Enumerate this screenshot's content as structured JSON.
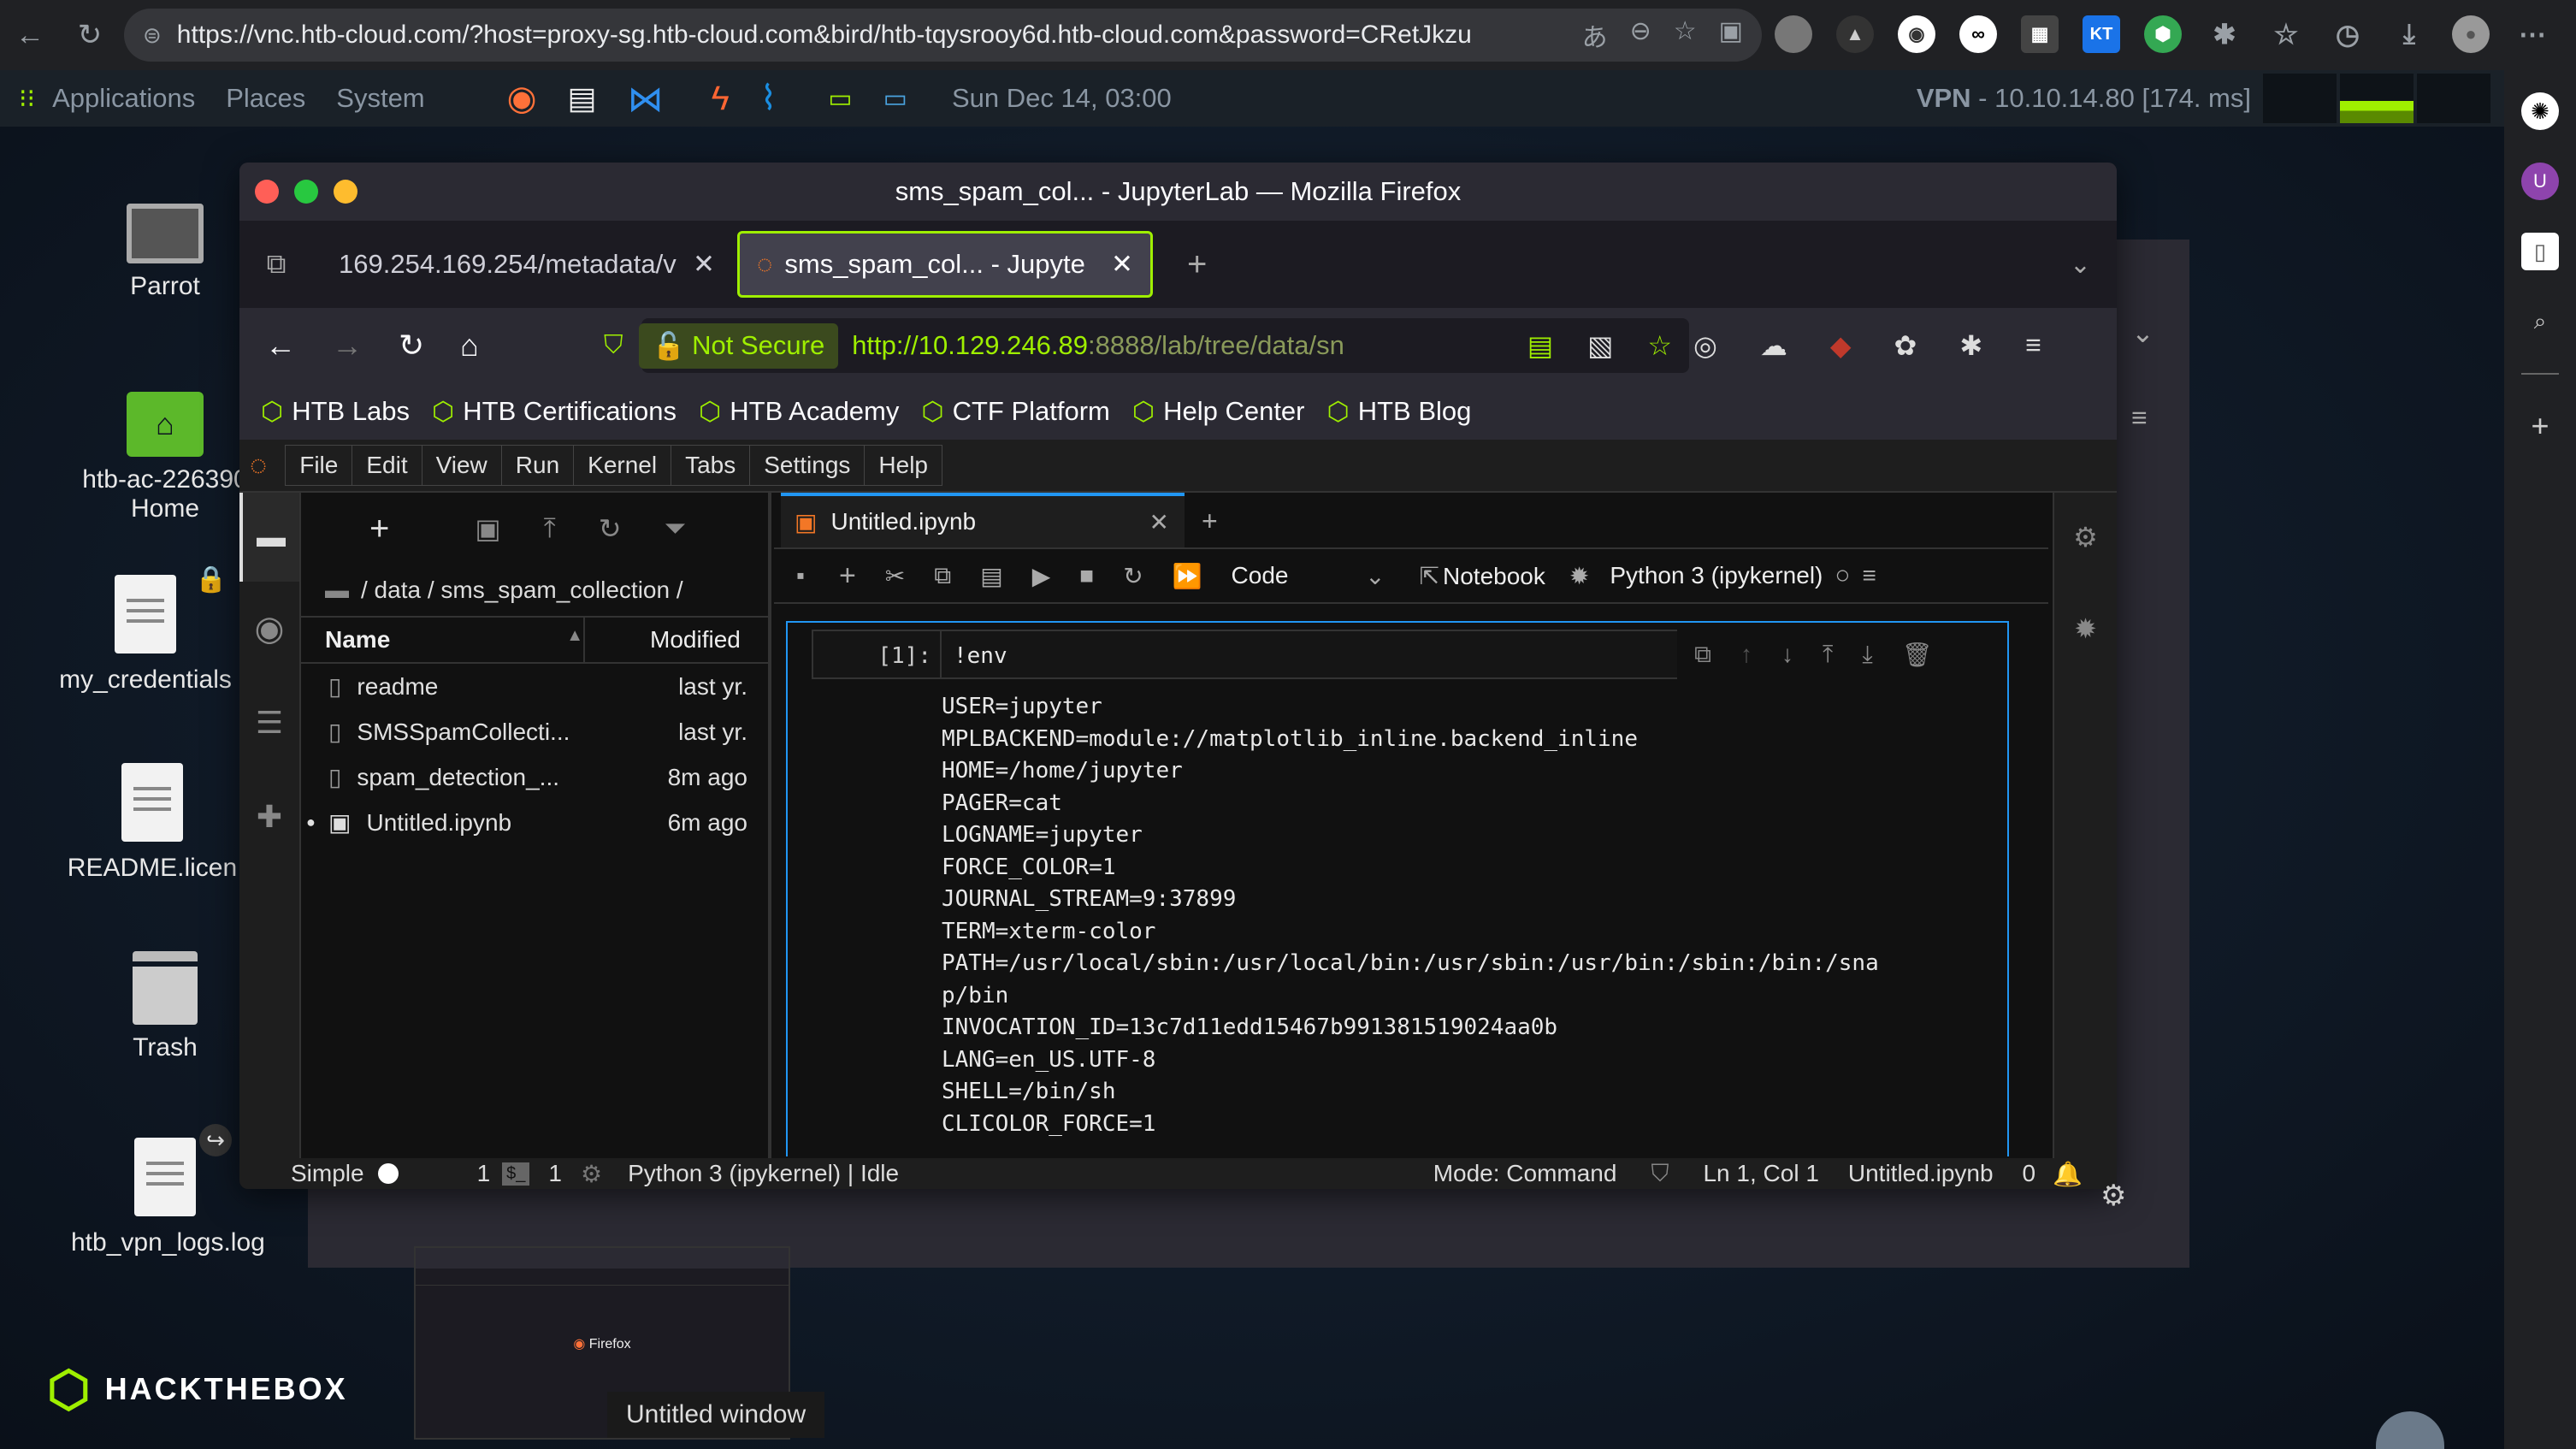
{
  "chrome": {
    "url": "https://vnc.htb-cloud.com/?host=proxy-sg.htb-cloud.com&bird/htb-tqysrooy6d.htb-cloud.com&password=CRetJkzu",
    "ext_badges": [
      "KT"
    ]
  },
  "panel": {
    "applications": "Applications",
    "places": "Places",
    "system": "System",
    "clock": "Sun Dec 14, 03:00",
    "vpn_label": "VPN",
    "vpn_value": " - 10.10.14.80 [174. ms]"
  },
  "desktop": {
    "icons": [
      "Parrot",
      "htb-ac-226390",
      "Home",
      "my_credentials",
      "README.licen",
      "Trash",
      "htb_vpn_logs.log"
    ],
    "logo": "HACKTHEBOX",
    "thumb_label": "Untitled window",
    "thumb_firefox": "Firefox"
  },
  "firefox": {
    "title": "sms_spam_col... - JupyterLab — Mozilla Firefox",
    "tabs": [
      "169.254.169.254/metadata/v",
      "sms_spam_col... - Jupyte"
    ],
    "not_secure": "Not Secure",
    "url_host": "http://10.129.246.89",
    "url_rest": ":8888/lab/tree/data/sn",
    "bookmarks": [
      "HTB Labs",
      "HTB Certifications",
      "HTB Academy",
      "CTF Platform",
      "Help Center",
      "HTB Blog"
    ]
  },
  "jupyter": {
    "menu": [
      "File",
      "Edit",
      "View",
      "Run",
      "Kernel",
      "Tabs",
      "Settings",
      "Help"
    ],
    "breadcrumb": "/ data / sms_spam_collection /",
    "col_name": "Name",
    "col_modified": "Modified",
    "files": [
      {
        "name": "readme",
        "modified": "last yr."
      },
      {
        "name": "SMSSpamCollecti...",
        "modified": "last yr."
      },
      {
        "name": "spam_detection_...",
        "modified": "8m ago"
      },
      {
        "name": "Untitled.ipynb",
        "modified": "6m ago"
      }
    ],
    "notebook_tab": "Untitled.ipynb",
    "cell_type": "Code",
    "notebook_label": "Notebook",
    "kernel": "Python 3 (ipykernel)",
    "prompt": "[1]:",
    "cell_source": "!env",
    "output": [
      "USER=jupyter",
      "MPLBACKEND=module://matplotlib_inline.backend_inline",
      "HOME=/home/jupyter",
      "PAGER=cat",
      "LOGNAME=jupyter",
      "FORCE_COLOR=1",
      "JOURNAL_STREAM=9:37899",
      "TERM=xterm-color",
      "PATH=/usr/local/sbin:/usr/local/bin:/usr/sbin:/usr/bin:/sbin:/bin:/sna",
      "p/bin",
      "INVOCATION_ID=13c7d11edd15467b991381519024aa0b",
      "LANG=en_US.UTF-8",
      "SHELL=/bin/sh",
      "CLICOLOR_FORCE=1"
    ],
    "status": {
      "simple": "Simple",
      "count1": "1",
      "count2": "1",
      "kernel_state": "Python 3 (ipykernel) | Idle",
      "mode": "Mode: Command",
      "position": "Ln 1, Col 1",
      "file": "Untitled.ipynb",
      "notifications": "0"
    }
  }
}
